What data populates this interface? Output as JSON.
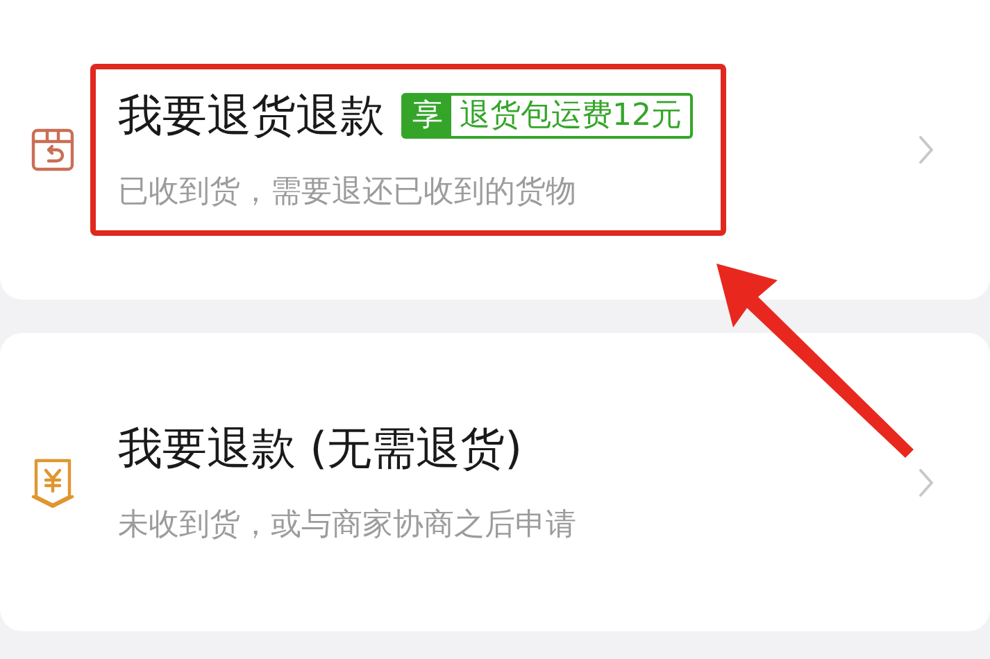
{
  "options": [
    {
      "kind": "return",
      "title": "我要退货退款",
      "badge": {
        "tag": "享",
        "text": "退货包运费12元"
      },
      "subtitle": "已收到货，需要退还已收到的货物",
      "highlighted": true
    },
    {
      "kind": "refund",
      "title": "我要退款 (无需退货)",
      "subtitle": "未收到货，或与商家协商之后申请",
      "highlighted": false
    }
  ]
}
